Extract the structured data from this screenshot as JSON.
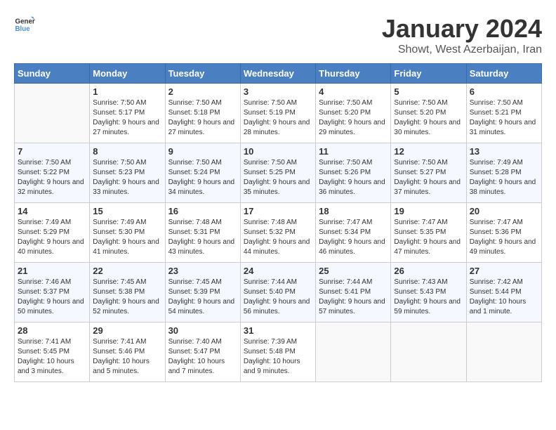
{
  "logo": {
    "text_general": "General",
    "text_blue": "Blue"
  },
  "title": "January 2024",
  "location": "Showt, West Azerbaijan, Iran",
  "days_of_week": [
    "Sunday",
    "Monday",
    "Tuesday",
    "Wednesday",
    "Thursday",
    "Friday",
    "Saturday"
  ],
  "weeks": [
    [
      {
        "day": "",
        "empty": true
      },
      {
        "day": "1",
        "sunrise": "Sunrise: 7:50 AM",
        "sunset": "Sunset: 5:17 PM",
        "daylight": "Daylight: 9 hours and 27 minutes."
      },
      {
        "day": "2",
        "sunrise": "Sunrise: 7:50 AM",
        "sunset": "Sunset: 5:18 PM",
        "daylight": "Daylight: 9 hours and 27 minutes."
      },
      {
        "day": "3",
        "sunrise": "Sunrise: 7:50 AM",
        "sunset": "Sunset: 5:19 PM",
        "daylight": "Daylight: 9 hours and 28 minutes."
      },
      {
        "day": "4",
        "sunrise": "Sunrise: 7:50 AM",
        "sunset": "Sunset: 5:20 PM",
        "daylight": "Daylight: 9 hours and 29 minutes."
      },
      {
        "day": "5",
        "sunrise": "Sunrise: 7:50 AM",
        "sunset": "Sunset: 5:20 PM",
        "daylight": "Daylight: 9 hours and 30 minutes."
      },
      {
        "day": "6",
        "sunrise": "Sunrise: 7:50 AM",
        "sunset": "Sunset: 5:21 PM",
        "daylight": "Daylight: 9 hours and 31 minutes."
      }
    ],
    [
      {
        "day": "7",
        "sunrise": "Sunrise: 7:50 AM",
        "sunset": "Sunset: 5:22 PM",
        "daylight": "Daylight: 9 hours and 32 minutes."
      },
      {
        "day": "8",
        "sunrise": "Sunrise: 7:50 AM",
        "sunset": "Sunset: 5:23 PM",
        "daylight": "Daylight: 9 hours and 33 minutes."
      },
      {
        "day": "9",
        "sunrise": "Sunrise: 7:50 AM",
        "sunset": "Sunset: 5:24 PM",
        "daylight": "Daylight: 9 hours and 34 minutes."
      },
      {
        "day": "10",
        "sunrise": "Sunrise: 7:50 AM",
        "sunset": "Sunset: 5:25 PM",
        "daylight": "Daylight: 9 hours and 35 minutes."
      },
      {
        "day": "11",
        "sunrise": "Sunrise: 7:50 AM",
        "sunset": "Sunset: 5:26 PM",
        "daylight": "Daylight: 9 hours and 36 minutes."
      },
      {
        "day": "12",
        "sunrise": "Sunrise: 7:50 AM",
        "sunset": "Sunset: 5:27 PM",
        "daylight": "Daylight: 9 hours and 37 minutes."
      },
      {
        "day": "13",
        "sunrise": "Sunrise: 7:49 AM",
        "sunset": "Sunset: 5:28 PM",
        "daylight": "Daylight: 9 hours and 38 minutes."
      }
    ],
    [
      {
        "day": "14",
        "sunrise": "Sunrise: 7:49 AM",
        "sunset": "Sunset: 5:29 PM",
        "daylight": "Daylight: 9 hours and 40 minutes."
      },
      {
        "day": "15",
        "sunrise": "Sunrise: 7:49 AM",
        "sunset": "Sunset: 5:30 PM",
        "daylight": "Daylight: 9 hours and 41 minutes."
      },
      {
        "day": "16",
        "sunrise": "Sunrise: 7:48 AM",
        "sunset": "Sunset: 5:31 PM",
        "daylight": "Daylight: 9 hours and 43 minutes."
      },
      {
        "day": "17",
        "sunrise": "Sunrise: 7:48 AM",
        "sunset": "Sunset: 5:32 PM",
        "daylight": "Daylight: 9 hours and 44 minutes."
      },
      {
        "day": "18",
        "sunrise": "Sunrise: 7:47 AM",
        "sunset": "Sunset: 5:34 PM",
        "daylight": "Daylight: 9 hours and 46 minutes."
      },
      {
        "day": "19",
        "sunrise": "Sunrise: 7:47 AM",
        "sunset": "Sunset: 5:35 PM",
        "daylight": "Daylight: 9 hours and 47 minutes."
      },
      {
        "day": "20",
        "sunrise": "Sunrise: 7:47 AM",
        "sunset": "Sunset: 5:36 PM",
        "daylight": "Daylight: 9 hours and 49 minutes."
      }
    ],
    [
      {
        "day": "21",
        "sunrise": "Sunrise: 7:46 AM",
        "sunset": "Sunset: 5:37 PM",
        "daylight": "Daylight: 9 hours and 50 minutes."
      },
      {
        "day": "22",
        "sunrise": "Sunrise: 7:45 AM",
        "sunset": "Sunset: 5:38 PM",
        "daylight": "Daylight: 9 hours and 52 minutes."
      },
      {
        "day": "23",
        "sunrise": "Sunrise: 7:45 AM",
        "sunset": "Sunset: 5:39 PM",
        "daylight": "Daylight: 9 hours and 54 minutes."
      },
      {
        "day": "24",
        "sunrise": "Sunrise: 7:44 AM",
        "sunset": "Sunset: 5:40 PM",
        "daylight": "Daylight: 9 hours and 56 minutes."
      },
      {
        "day": "25",
        "sunrise": "Sunrise: 7:44 AM",
        "sunset": "Sunset: 5:41 PM",
        "daylight": "Daylight: 9 hours and 57 minutes."
      },
      {
        "day": "26",
        "sunrise": "Sunrise: 7:43 AM",
        "sunset": "Sunset: 5:43 PM",
        "daylight": "Daylight: 9 hours and 59 minutes."
      },
      {
        "day": "27",
        "sunrise": "Sunrise: 7:42 AM",
        "sunset": "Sunset: 5:44 PM",
        "daylight": "Daylight: 10 hours and 1 minute."
      }
    ],
    [
      {
        "day": "28",
        "sunrise": "Sunrise: 7:41 AM",
        "sunset": "Sunset: 5:45 PM",
        "daylight": "Daylight: 10 hours and 3 minutes."
      },
      {
        "day": "29",
        "sunrise": "Sunrise: 7:41 AM",
        "sunset": "Sunset: 5:46 PM",
        "daylight": "Daylight: 10 hours and 5 minutes."
      },
      {
        "day": "30",
        "sunrise": "Sunrise: 7:40 AM",
        "sunset": "Sunset: 5:47 PM",
        "daylight": "Daylight: 10 hours and 7 minutes."
      },
      {
        "day": "31",
        "sunrise": "Sunrise: 7:39 AM",
        "sunset": "Sunset: 5:48 PM",
        "daylight": "Daylight: 10 hours and 9 minutes."
      },
      {
        "day": "",
        "empty": true
      },
      {
        "day": "",
        "empty": true
      },
      {
        "day": "",
        "empty": true
      }
    ]
  ]
}
